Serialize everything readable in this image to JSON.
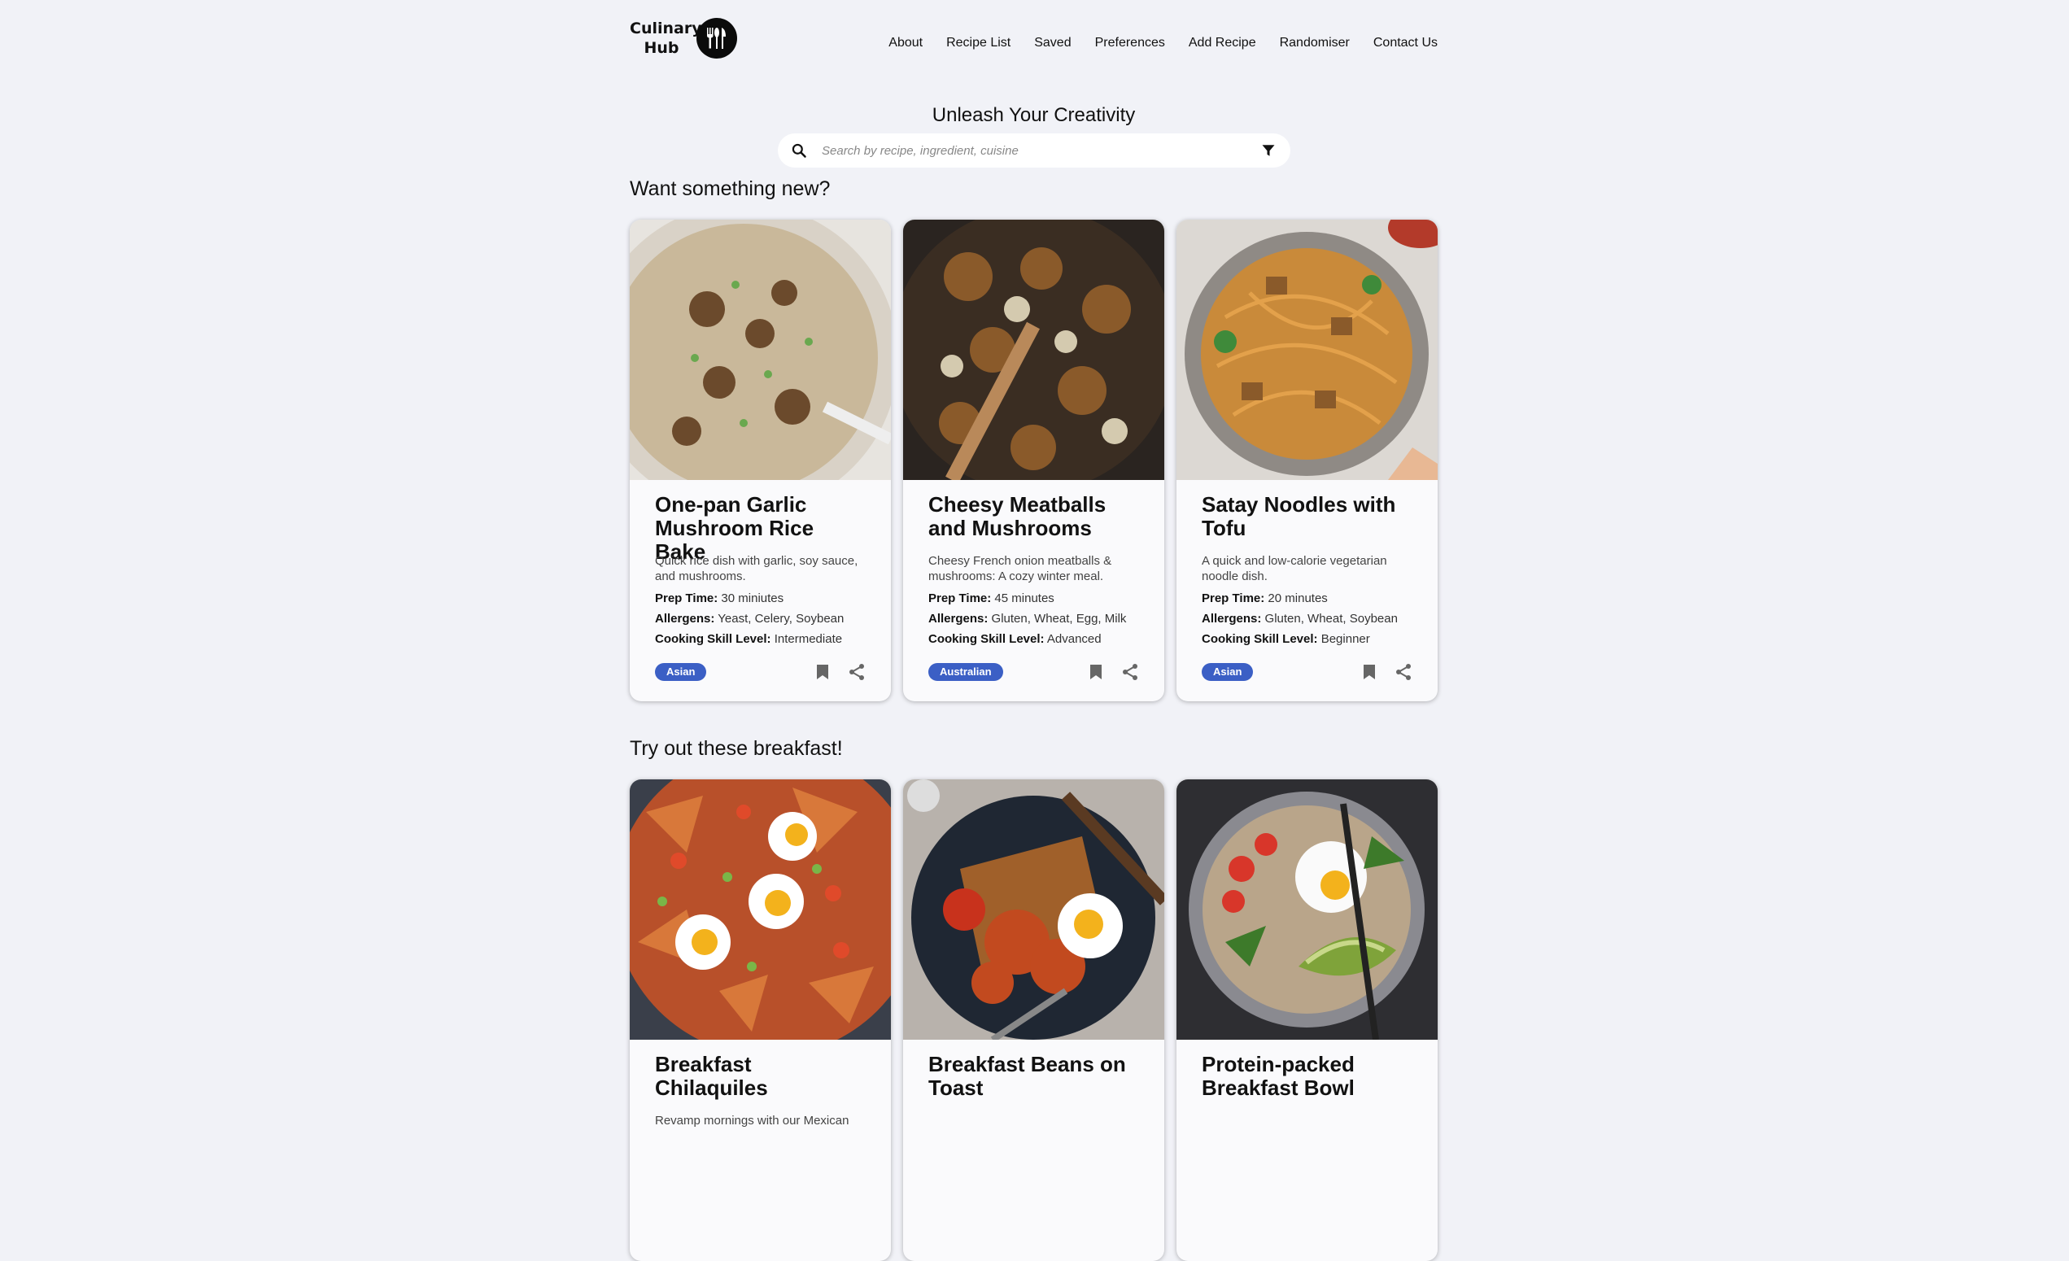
{
  "brand": {
    "name": "Culinary Hub"
  },
  "nav": [
    "About",
    "Recipe List",
    "Saved",
    "Preferences",
    "Add Recipe",
    "Randomiser",
    "Contact Us"
  ],
  "hero": {
    "title": "Unleash Your Creativity"
  },
  "search": {
    "placeholder": "Search by recipe, ingredient, cuisine"
  },
  "labels": {
    "prep": "Prep Time:",
    "allergens": "Allergens:",
    "skill": "Cooking Skill Level:"
  },
  "sections": [
    {
      "title": "Want something new?",
      "cards": [
        {
          "title": "One-pan Garlic Mushroom Rice Bake",
          "desc": "Quick rice dish with garlic, soy sauce, and mushrooms.",
          "prep": "30 miniutes",
          "allergens": "Yeast, Celery, Soybean",
          "skill": "Intermediate",
          "tag": "Asian"
        },
        {
          "title": "Cheesy Meatballs and Mushrooms",
          "desc": "Cheesy French onion meatballs & mushrooms: A cozy winter meal.",
          "prep": "45 minutes",
          "allergens": "Gluten, Wheat, Egg, Milk",
          "skill": "Advanced",
          "tag": "Australian"
        },
        {
          "title": "Satay Noodles with Tofu",
          "desc": "A quick and low-calorie vegetarian noodle dish.",
          "prep": "20 minutes",
          "allergens": "Gluten, Wheat, Soybean",
          "skill": "Beginner",
          "tag": "Asian"
        }
      ]
    },
    {
      "title": "Try out these breakfast!",
      "cards": [
        {
          "title": "Breakfast Chilaquiles",
          "desc": "Revamp mornings with our Mexican",
          "prep": "",
          "allergens": "",
          "skill": "",
          "tag": ""
        },
        {
          "title": "Breakfast Beans on Toast",
          "desc": "",
          "prep": "",
          "allergens": "",
          "skill": "",
          "tag": ""
        },
        {
          "title": "Protein-packed Breakfast Bowl",
          "desc": "",
          "prep": "",
          "allergens": "",
          "skill": "",
          "tag": ""
        }
      ]
    }
  ],
  "colors": {
    "background": "#f1f2f7",
    "tag": "#3b5fc5",
    "card": "#fafafc"
  }
}
